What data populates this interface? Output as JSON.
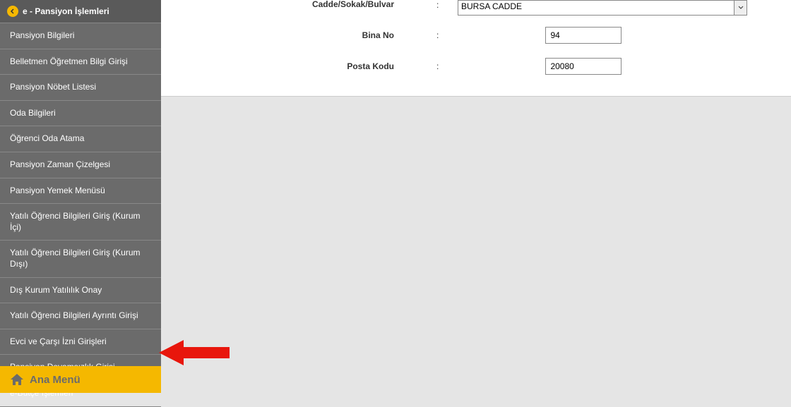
{
  "sidebar": {
    "header": "e - Pansiyon İşlemleri",
    "items": [
      "Pansiyon Bilgileri",
      "Belletmen Öğretmen Bilgi Girişi",
      "Pansiyon Nöbet Listesi",
      "Oda Bilgileri",
      "Öğrenci Oda Atama",
      "Pansiyon Zaman Çizelgesi",
      "Pansiyon Yemek Menüsü",
      "Yatılı Öğrenci Bilgileri Giriş (Kurum İçi)",
      "Yatılı Öğrenci Bilgileri Giriş (Kurum Dışı)",
      "Dış Kurum Yatılılık Onay",
      "Yatılı Öğrenci Bilgileri Ayrıntı Girişi",
      "Evci ve Çarşı İzni Girişleri",
      "Pansiyon Devamsızlık Girişi",
      "e-Bütçe İşlemleri"
    ],
    "home": "Ana Menü"
  },
  "form": {
    "cadde_label": "Cadde/Sokak/Bulvar",
    "cadde_value": "BURSA CADDE",
    "bina_label": "Bina No",
    "bina_value": "94",
    "posta_label": "Posta Kodu",
    "posta_value": "20080",
    "colon": ":"
  }
}
